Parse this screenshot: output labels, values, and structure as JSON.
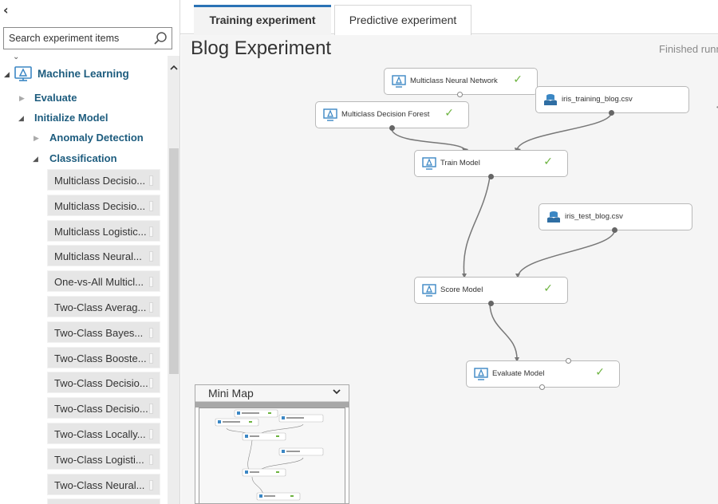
{
  "sidebar": {
    "collapse_glyph": "‹",
    "search_placeholder": "Search experiment items",
    "search_icon": "search-icon",
    "scroll_stub": "⌄",
    "tree": {
      "machine_learning": "Machine Learning",
      "evaluate": "Evaluate",
      "initialize_model": "Initialize Model",
      "anomaly_detection": "Anomaly Detection",
      "classification": "Classification"
    },
    "modules": [
      "Multiclass Decisio...",
      "Multiclass Decisio...",
      "Multiclass Logistic...",
      "Multiclass Neural...",
      "One-vs-All Multicl...",
      "Two-Class Averag...",
      "Two-Class Bayes...",
      "Two-Class Booste...",
      "Two-Class Decisio...",
      "Two-Class Decisio...",
      "Two-Class Locally...",
      "Two-Class Logisti...",
      "Two-Class Neural...",
      ""
    ]
  },
  "tabs": [
    {
      "label": "Training experiment",
      "active": true
    },
    {
      "label": "Predictive experiment",
      "active": false
    }
  ],
  "experiment": {
    "title": "Blog Experiment",
    "status": "Finished runn"
  },
  "nodes": {
    "neural_network": {
      "label": "Multiclass Neural Network",
      "icon": "module-icon",
      "done": true
    },
    "decision_forest": {
      "label": "Multiclass Decision Forest",
      "icon": "module-icon",
      "done": true
    },
    "training_data": {
      "label": "iris_training_blog.csv",
      "icon": "dataset-icon",
      "done": false
    },
    "train_model": {
      "label": "Train Model",
      "icon": "module-icon",
      "done": true
    },
    "test_data": {
      "label": "iris_test_blog.csv",
      "icon": "dataset-icon",
      "done": false
    },
    "score_model": {
      "label": "Score Model",
      "icon": "module-icon",
      "done": true
    },
    "evaluate_model": {
      "label": "Evaluate Model",
      "icon": "module-icon",
      "done": true
    }
  },
  "check_glyph": "✓",
  "minimap": {
    "title": "Mini Map",
    "toggle_icon": "chevron-down-icon"
  },
  "colors": {
    "accent": "#2a72b5",
    "tree_text": "#1d5c7e",
    "success": "#6cb33f",
    "icon_blue": "#3b87c4"
  }
}
